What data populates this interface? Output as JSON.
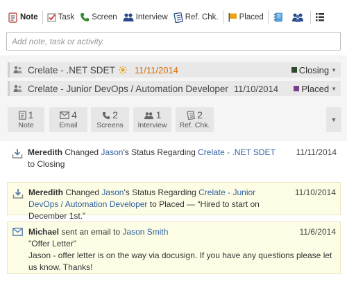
{
  "toolbar": {
    "note": "Note",
    "task": "Task",
    "screen": "Screen",
    "interview": "Interview",
    "ref_check": "Ref. Chk.",
    "placed": "Placed"
  },
  "note_input": {
    "placeholder": "Add note, task or activity."
  },
  "relations": [
    {
      "title": "Crelate - .NET SDET",
      "date": "11/11/2014",
      "status": "Closing",
      "status_color": "#2e4a2e"
    },
    {
      "title": "Crelate - Junior DevOps / Automation Developer",
      "date": "11/10/2014",
      "status": "Placed",
      "status_color": "#7a3f8c"
    }
  ],
  "counters": [
    {
      "count": "1",
      "label": "Note",
      "icon": "note-icon"
    },
    {
      "count": "4",
      "label": "Email",
      "icon": "envelope-icon"
    },
    {
      "count": "2",
      "label": "Screens",
      "icon": "phone-icon"
    },
    {
      "count": "1",
      "label": "Interview",
      "icon": "people-icon"
    },
    {
      "count": "2",
      "label": "Ref. Chk.",
      "icon": "checklist-icon"
    }
  ],
  "activities": [
    {
      "actor": "Meredith",
      "text1": " Changed ",
      "person": "Jason",
      "text2": "'s Status Regarding ",
      "job": "Crelate - .NET SDET",
      "text3": " to Closing",
      "date": "11/11/2014"
    },
    {
      "actor": "Meredith",
      "text1": " Changed ",
      "person": "Jason",
      "text2": "'s Status Regarding ",
      "job": "Crelate - Junior DevOps / Automation Developer",
      "text3": " to Placed — “Hired to start on December 1st.”",
      "date": "11/10/2014"
    },
    {
      "actor": "Michael",
      "text1": " sent an email to ",
      "person": "Jason Smith",
      "subject": "\"Offer Letter\"",
      "body": "Jason - offer letter is on the way via docusign. If you have any questions please let us know. Thanks!",
      "date": "11/6/2014"
    }
  ],
  "colors": {
    "link": "#2e5f9e",
    "highlight_date": "#d96b00",
    "yellow_bg": "#fdfde6",
    "placed_flag": "#e8a317"
  }
}
